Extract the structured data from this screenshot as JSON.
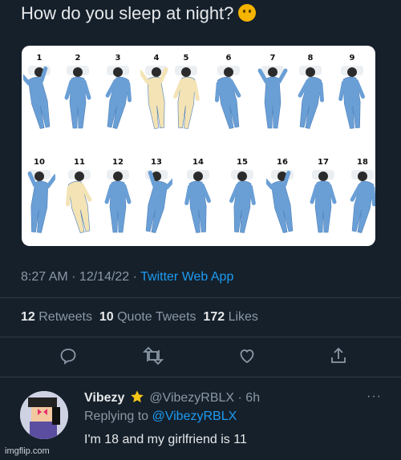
{
  "tweet": {
    "title": "How do you sleep at night?",
    "title_emoji": "thinking-face-emoji",
    "figure_numbers": [
      "1",
      "2",
      "3",
      "4",
      "5",
      "6",
      "7",
      "8",
      "9",
      "10",
      "11",
      "12",
      "13",
      "14",
      "15",
      "16",
      "17",
      "18"
    ],
    "timestamp": "8:27 AM · 12/14/22 · ",
    "source_app": "Twitter Web App",
    "stats": {
      "retweets_count": "12",
      "retweets_label": "Retweets",
      "quotes_count": "10",
      "quotes_label": "Quote Tweets",
      "likes_count": "172",
      "likes_label": "Likes"
    },
    "actions": [
      "reply-icon",
      "retweet-icon",
      "like-icon",
      "share-icon"
    ]
  },
  "reply": {
    "name": "Vibezy",
    "badge": "star-emoji",
    "handle": "@VibezyRBLX · 6h",
    "more": "···",
    "replying_prefix": "Replying to ",
    "replying_handle": "@VibezyRBLX",
    "text": "I'm 18 and my girlfriend is 11"
  },
  "watermark": "imgflip.com",
  "colors": {
    "background": "#15202b",
    "accent": "#1d9bf0",
    "muted": "#8b98a5",
    "pajama_blue": "#6a9fd6",
    "pajama_cream": "#f3e3b5"
  }
}
